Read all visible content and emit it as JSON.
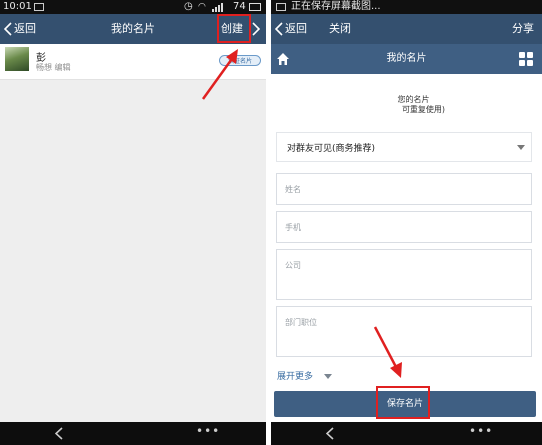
{
  "left": {
    "status": {
      "time": "10:01",
      "battery": "74"
    },
    "nav": {
      "back_label": "返回",
      "title": "我的名片",
      "create_label": "创建"
    },
    "card": {
      "name": "彭",
      "subtitle": "畅想 编辑",
      "badge": "认证名片"
    }
  },
  "right": {
    "status": {
      "text": "正在保存屏幕截图..."
    },
    "nav": {
      "back_label": "返回",
      "close_label": "关闭",
      "share_label": "分享"
    },
    "subbar": {
      "title": "我的名片"
    },
    "header": {
      "line1": "您的名片",
      "line2": "可重复使用)"
    },
    "visibility": {
      "value": "对群友可见(商务推荐)"
    },
    "fields": {
      "name_placeholder": "姓名",
      "phone_placeholder": "手机",
      "company_placeholder": "公司",
      "department_placeholder": "部门职位"
    },
    "expand_label": "展开更多",
    "save_label": "保存名片"
  },
  "colors": {
    "nav": "#34506f",
    "accent_red": "#e02020",
    "save_button": "#3f5f83"
  }
}
